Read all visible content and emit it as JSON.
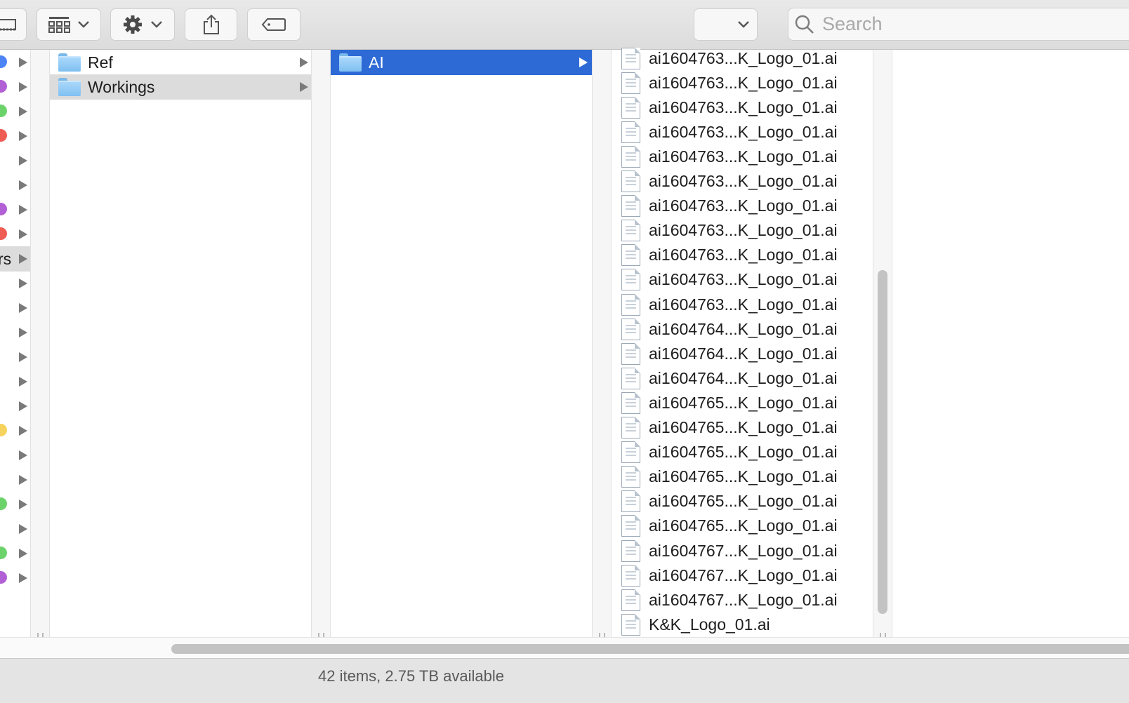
{
  "toolbar": {
    "view_button_icon": "column-view-icon",
    "group_button_icon": "grid-icon",
    "action_button_icon": "gear-icon",
    "share_button_icon": "share-icon",
    "tag_button_icon": "tag-icon",
    "dropdown_icon": "chevron-down-icon",
    "search_placeholder": "Search"
  },
  "sidebar_column": {
    "partial_label": "rs",
    "tag_colors": [
      "#4c84f5",
      "#b260d6",
      "#6cd36b",
      "#ef5c53",
      "",
      "",
      "#b260d6",
      "#ef5c53",
      "",
      "",
      "",
      "",
      "",
      "",
      "",
      "#f6d35d",
      "",
      "",
      "#6cd36b",
      "",
      "#6cd36b",
      "#b260d6"
    ]
  },
  "column1": {
    "items": [
      {
        "label": "Ref",
        "type": "folder"
      },
      {
        "label": "Workings",
        "type": "folder"
      }
    ]
  },
  "column2": {
    "items": [
      {
        "label": "AI",
        "type": "folder",
        "selected": true
      }
    ]
  },
  "column3": {
    "files": [
      "ai1604763...K_Logo_01.ai",
      "ai1604763...K_Logo_01.ai",
      "ai1604763...K_Logo_01.ai",
      "ai1604763...K_Logo_01.ai",
      "ai1604763...K_Logo_01.ai",
      "ai1604763...K_Logo_01.ai",
      "ai1604763...K_Logo_01.ai",
      "ai1604763...K_Logo_01.ai",
      "ai1604763...K_Logo_01.ai",
      "ai1604763...K_Logo_01.ai",
      "ai1604763...K_Logo_01.ai",
      "ai1604764...K_Logo_01.ai",
      "ai1604764...K_Logo_01.ai",
      "ai1604764...K_Logo_01.ai",
      "ai1604765...K_Logo_01.ai",
      "ai1604765...K_Logo_01.ai",
      "ai1604765...K_Logo_01.ai",
      "ai1604765...K_Logo_01.ai",
      "ai1604765...K_Logo_01.ai",
      "ai1604765...K_Logo_01.ai",
      "ai1604767...K_Logo_01.ai",
      "ai1604767...K_Logo_01.ai",
      "ai1604767...K_Logo_01.ai",
      "K&K_Logo_01.ai"
    ]
  },
  "status": {
    "text": "42 items, 2.75 TB available"
  },
  "colors": {
    "selection": "#2d6ad6",
    "selection_inactive": "#dcdcdc"
  }
}
